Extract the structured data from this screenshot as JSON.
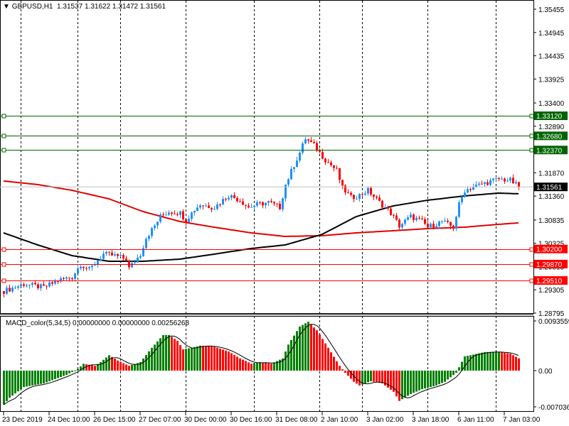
{
  "header": {
    "symbol": "GBPUSD,H1",
    "open": "1.31537",
    "high": "1.31622",
    "low": "1.31472",
    "close": "1.31561"
  },
  "indicator": {
    "name": "MACD_color(5,34,5)",
    "v1": "0.00000000",
    "v2": "0.00000000",
    "v3": "0.00256268"
  },
  "colors": {
    "up": "#1e90ff",
    "down": "#ff0000",
    "support": "#ff0000",
    "resistance": "#006400",
    "ma_fast": "#000000",
    "ma_slow": "#e00000",
    "hist_up": "#008000",
    "hist_down": "#ff0000"
  },
  "chart_data": {
    "type": "candlestick",
    "title": "GBPUSD,H1",
    "ylim": [
      1.28795,
      1.35455
    ],
    "price_ticks": [
      "1.35455",
      "1.34945",
      "1.34435",
      "1.33925",
      "1.33400",
      "1.32890",
      "1.31870",
      "1.31360",
      "1.30835",
      "1.30325",
      "1.29815",
      "1.29305",
      "1.28795"
    ],
    "current_price": "1.31561",
    "resistance_levels": [
      "1.33120",
      "1.32680",
      "1.32370"
    ],
    "support_levels": [
      "1.30200",
      "1.29870",
      "1.29510"
    ],
    "time_labels": [
      "23 Dec 2019",
      "24 Dec 10:00",
      "26 Dec 15:00",
      "27 Dec 07:00",
      "30 Dec 00:00",
      "30 Dec 16:00",
      "31 Dec 08:00",
      "2 Jan 10:00",
      "3 Jan 02:00",
      "3 Jan 18:00",
      "6 Jan 11:00",
      "7 Jan 03:00"
    ],
    "bars_per_label": 16,
    "grid_bars": [
      6,
      26,
      41,
      64,
      88,
      111,
      126,
      149,
      173
    ],
    "close_path": [
      [
        0,
        1.29278
      ],
      [
        7,
        1.29433
      ],
      [
        14,
        1.29356
      ],
      [
        19,
        1.29511
      ],
      [
        24,
        1.29589
      ],
      [
        27,
        1.29869
      ],
      [
        30,
        1.29745
      ],
      [
        35,
        1.30087
      ],
      [
        39,
        1.30056
      ],
      [
        43,
        1.29978
      ],
      [
        44,
        1.29776
      ],
      [
        48,
        1.30087
      ],
      [
        50,
        1.30445
      ],
      [
        53,
        1.30709
      ],
      [
        55,
        1.30912
      ],
      [
        58,
        1.31021
      ],
      [
        62,
        1.30989
      ],
      [
        64,
        1.30834
      ],
      [
        67,
        1.31067
      ],
      [
        69,
        1.31176
      ],
      [
        74,
        1.31114
      ],
      [
        79,
        1.31378
      ],
      [
        83,
        1.31269
      ],
      [
        86,
        1.31114
      ],
      [
        89,
        1.31176
      ],
      [
        93,
        1.31223
      ],
      [
        97,
        1.31114
      ],
      [
        99,
        1.31612
      ],
      [
        102,
        1.32047
      ],
      [
        104,
        1.32312
      ],
      [
        106,
        1.32623
      ],
      [
        109,
        1.32468
      ],
      [
        113,
        1.32156
      ],
      [
        117,
        1.31923
      ],
      [
        119,
        1.31534
      ],
      [
        122,
        1.31332
      ],
      [
        125,
        1.31378
      ],
      [
        128,
        1.31487
      ],
      [
        132,
        1.31223
      ],
      [
        136,
        1.30989
      ],
      [
        139,
        1.30709
      ],
      [
        143,
        1.30912
      ],
      [
        147,
        1.30803
      ],
      [
        149,
        1.30678
      ],
      [
        154,
        1.30803
      ],
      [
        158,
        1.30678
      ],
      [
        160,
        1.31176
      ],
      [
        162,
        1.31487
      ],
      [
        166,
        1.31581
      ],
      [
        169,
        1.31643
      ],
      [
        174,
        1.31736
      ],
      [
        178,
        1.31705
      ],
      [
        181,
        1.31561
      ]
    ],
    "ma_fast": [
      [
        0,
        1.30554
      ],
      [
        12,
        1.30289
      ],
      [
        24,
        1.30056
      ],
      [
        37,
        1.29931
      ],
      [
        49,
        1.29931
      ],
      [
        62,
        1.29978
      ],
      [
        74,
        1.30087
      ],
      [
        87,
        1.30211
      ],
      [
        99,
        1.30289
      ],
      [
        112,
        1.30522
      ],
      [
        124,
        1.30912
      ],
      [
        137,
        1.31145
      ],
      [
        149,
        1.31269
      ],
      [
        162,
        1.31363
      ],
      [
        174,
        1.31425
      ],
      [
        181,
        1.3141
      ]
    ],
    "ma_slow": [
      [
        0,
        1.3169
      ],
      [
        12,
        1.31612
      ],
      [
        24,
        1.31487
      ],
      [
        37,
        1.313
      ],
      [
        49,
        1.31021
      ],
      [
        62,
        1.30803
      ],
      [
        74,
        1.30678
      ],
      [
        87,
        1.30554
      ],
      [
        99,
        1.30476
      ],
      [
        112,
        1.30492
      ],
      [
        124,
        1.30554
      ],
      [
        137,
        1.30601
      ],
      [
        149,
        1.30647
      ],
      [
        162,
        1.30678
      ],
      [
        174,
        1.30741
      ],
      [
        181,
        1.30772
      ]
    ],
    "macd": {
      "ylim": [
        -0.007036,
        0.0093559
      ],
      "ticks": [
        "0.0093559",
        "0.00",
        "-0.007036"
      ],
      "histogram": [
        [
          0,
          -0.0064
        ],
        [
          2,
          -0.0051
        ],
        [
          7,
          -0.0031
        ],
        [
          14,
          -0.0024
        ],
        [
          22,
          -0.0008
        ],
        [
          26,
          0.0003
        ],
        [
          28,
          0.0013
        ],
        [
          32,
          0.0009
        ],
        [
          34,
          0.0016
        ],
        [
          37,
          0.0029
        ],
        [
          40,
          0.0019
        ],
        [
          44,
          0.0009
        ],
        [
          48,
          0.0016
        ],
        [
          52,
          0.0043
        ],
        [
          56,
          0.0067
        ],
        [
          58,
          0.0067
        ],
        [
          61,
          0.0056
        ],
        [
          63,
          0.004
        ],
        [
          66,
          0.0043
        ],
        [
          69,
          0.0047
        ],
        [
          74,
          0.0045
        ],
        [
          79,
          0.0036
        ],
        [
          83,
          0.0023
        ],
        [
          87,
          0.0013
        ],
        [
          90,
          0.0016
        ],
        [
          94,
          0.0013
        ],
        [
          98,
          0.0023
        ],
        [
          100,
          0.0049
        ],
        [
          104,
          0.0083
        ],
        [
          107,
          0.0092
        ],
        [
          110,
          0.0076
        ],
        [
          114,
          0.0043
        ],
        [
          118,
          0.0009
        ],
        [
          120,
          -0.0004
        ],
        [
          123,
          -0.0021
        ],
        [
          125,
          -0.0028
        ],
        [
          129,
          -0.002
        ],
        [
          133,
          -0.0024
        ],
        [
          137,
          -0.004
        ],
        [
          139,
          -0.0057
        ],
        [
          143,
          -0.0044
        ],
        [
          147,
          -0.0035
        ],
        [
          152,
          -0.0028
        ],
        [
          155,
          -0.0021
        ],
        [
          159,
          -0.0004
        ],
        [
          162,
          0.0027
        ],
        [
          164,
          0.0029
        ],
        [
          169,
          0.0035
        ],
        [
          174,
          0.0035
        ],
        [
          178,
          0.0032
        ],
        [
          181,
          0.0023
        ]
      ]
    }
  }
}
